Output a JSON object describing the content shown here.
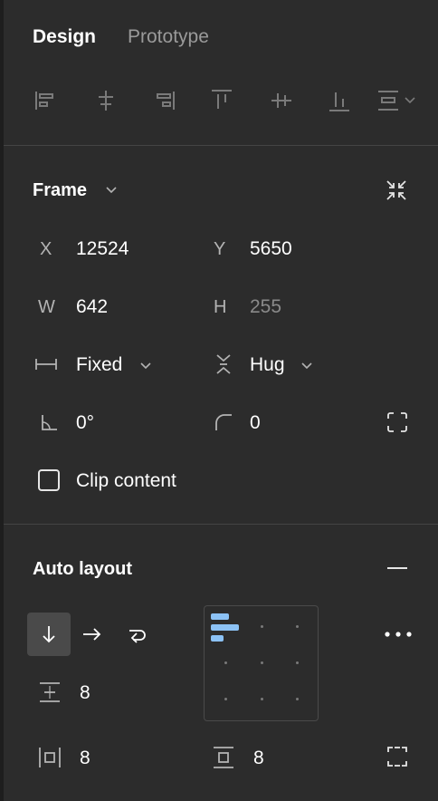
{
  "tabs": [
    {
      "label": "Design",
      "active": true
    },
    {
      "label": "Prototype",
      "active": false
    }
  ],
  "align_toolbar": {
    "icons": [
      "align-left-icon",
      "align-horizontal-center-icon",
      "align-right-icon",
      "align-top-icon",
      "align-vertical-center-icon",
      "align-bottom-icon",
      "distribute-dropdown-icon"
    ]
  },
  "frame": {
    "title": "Frame",
    "x": {
      "label": "X",
      "value": "12524"
    },
    "y": {
      "label": "Y",
      "value": "5650"
    },
    "w": {
      "label": "W",
      "value": "642"
    },
    "h": {
      "label": "H",
      "value": "255"
    },
    "width_mode": "Fixed",
    "height_mode": "Hug",
    "rotation": "0°",
    "corner_radius": "0",
    "clip_content_label": "Clip content",
    "clip_content_checked": false
  },
  "auto_layout": {
    "title": "Auto layout",
    "direction": "vertical",
    "gap": "8",
    "padding_horizontal": "8",
    "padding_vertical": "8"
  },
  "colors": {
    "background": "#2c2c2c",
    "accent": "#8cc2f5",
    "text": "#ffffff",
    "muted": "#9a9a9a"
  }
}
